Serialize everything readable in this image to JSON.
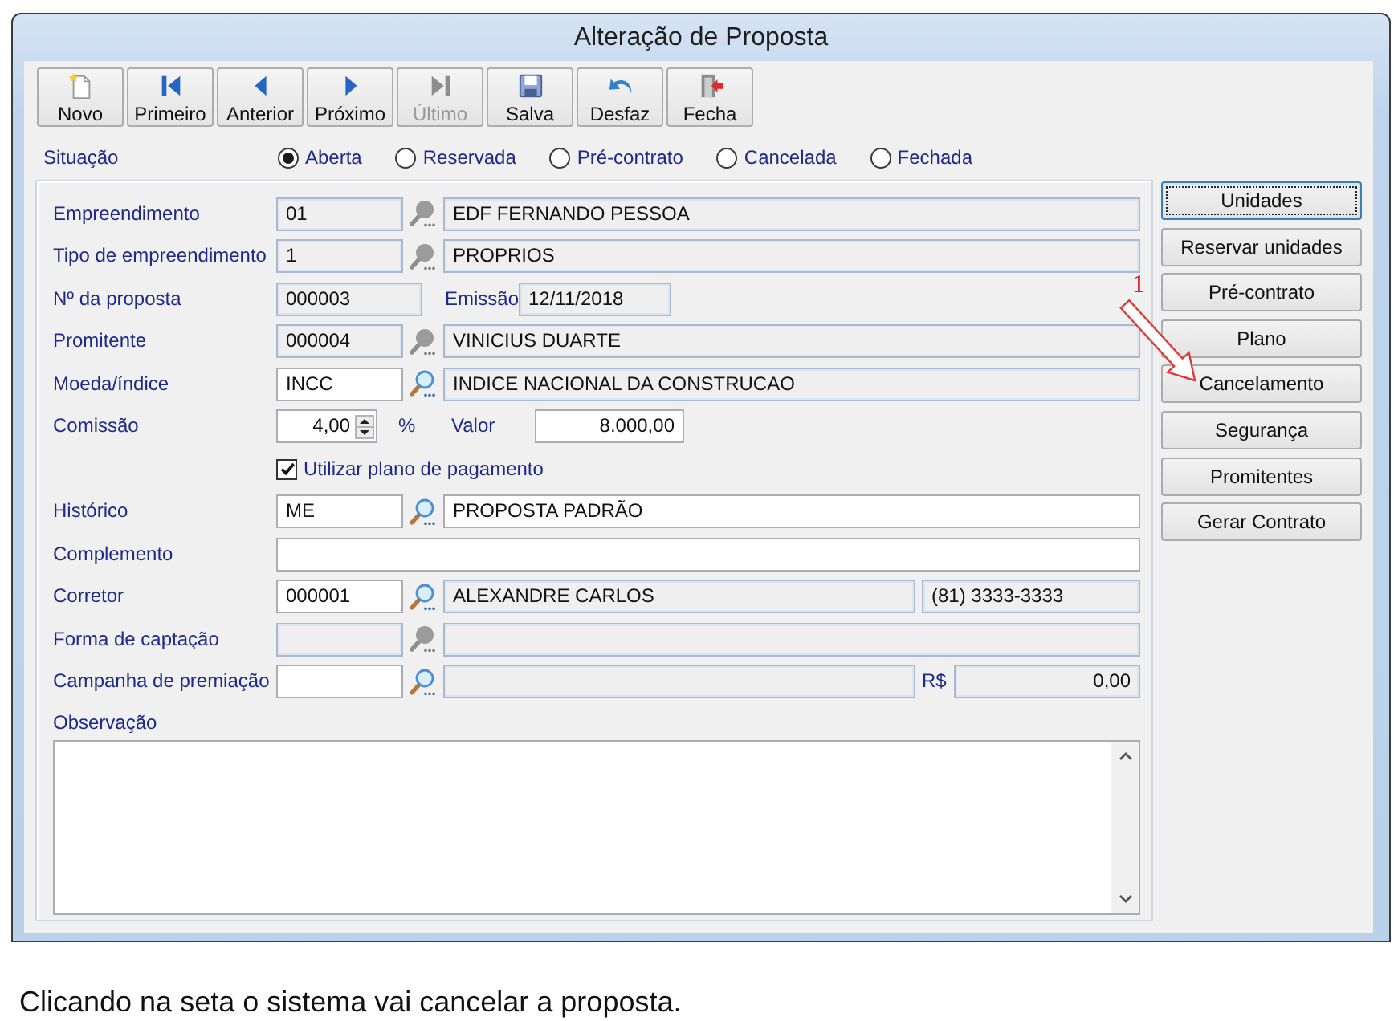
{
  "window": {
    "title": "Alteração de Proposta"
  },
  "toolbar": [
    {
      "kind": "new",
      "label": "Novo",
      "disabled": false
    },
    {
      "kind": "first",
      "label": "Primeiro",
      "disabled": false
    },
    {
      "kind": "previous",
      "label": "Anterior",
      "disabled": false
    },
    {
      "kind": "next",
      "label": "Próximo",
      "disabled": false
    },
    {
      "kind": "last",
      "label": "Último",
      "disabled": true
    },
    {
      "kind": "save",
      "label": "Salva",
      "disabled": false
    },
    {
      "kind": "undo",
      "label": "Desfaz",
      "disabled": false
    },
    {
      "kind": "exit",
      "label": "Fecha",
      "disabled": false
    }
  ],
  "situation": {
    "label": "Situação",
    "options": [
      {
        "label": "Aberta",
        "selected": true
      },
      {
        "label": "Reservada",
        "selected": false
      },
      {
        "label": "Pré-contrato",
        "selected": false
      },
      {
        "label": "Cancelada",
        "selected": false
      },
      {
        "label": "Fechada",
        "selected": false
      }
    ]
  },
  "form": [
    {
      "kind": "lookup",
      "label": "Empreendimento",
      "code": {
        "value": "01",
        "editable": false
      },
      "search_enabled": false,
      "description": {
        "value": "EDF FERNANDO PESSOA",
        "editable": false
      }
    },
    {
      "kind": "lookup",
      "label": "Tipo de empreendimento",
      "code": {
        "value": "1",
        "editable": false
      },
      "search_enabled": false,
      "description": {
        "value": "PROPRIOS",
        "editable": false
      }
    },
    {
      "kind": "number_date",
      "label": "Nº da proposta",
      "number": {
        "value": "000003",
        "editable": false
      },
      "date_label": "Emissão",
      "date": {
        "value": "12/11/2018",
        "editable": false
      }
    },
    {
      "kind": "lookup",
      "label": "Promitente",
      "code": {
        "value": "000004",
        "editable": false
      },
      "search_enabled": false,
      "description": {
        "value": "VINICIUS DUARTE",
        "editable": false
      }
    },
    {
      "kind": "lookup",
      "label": "Moeda/índice",
      "code": {
        "value": "INCC",
        "editable": true
      },
      "search_enabled": true,
      "description": {
        "value": "INDICE NACIONAL DA CONSTRUCAO",
        "editable": false
      }
    },
    {
      "kind": "percent_amount",
      "label": "Comissão",
      "percent": {
        "value": "4,00",
        "editable": true
      },
      "unit": "%",
      "amount_label": "Valor",
      "amount": {
        "value": "8.000,00",
        "editable": true
      }
    },
    {
      "kind": "checkbox",
      "label": "Utilizar plano de pagamento",
      "checked": true
    },
    {
      "kind": "lookup",
      "label": "Histórico",
      "code": {
        "value": "ME",
        "editable": true
      },
      "search_enabled": true,
      "description": {
        "value": "PROPOSTA PADRÃO",
        "editable": true
      }
    },
    {
      "kind": "text",
      "label": "Complemento",
      "field": {
        "editable": true
      }
    },
    {
      "kind": "lookup_phone",
      "label": "Corretor",
      "code": {
        "value": "000001",
        "editable": true
      },
      "search_enabled": true,
      "description": {
        "value": "ALEXANDRE CARLOS",
        "editable": false
      },
      "phone": {
        "value": "(81) 3333-3333",
        "editable": false
      }
    },
    {
      "kind": "lookup",
      "label": "Forma de captação",
      "code": {
        "editable": false
      },
      "search_enabled": false,
      "description": {
        "editable": false
      }
    },
    {
      "kind": "lookup_amount",
      "label": "Campanha de premiação",
      "code": {
        "editable": true
      },
      "search_enabled": true,
      "description": {
        "editable": false
      },
      "currency_label": "R$",
      "amount": {
        "value": "0,00",
        "editable": false
      }
    },
    {
      "kind": "memo",
      "label": "Observação",
      "field": {
        "editable": true
      }
    }
  ],
  "actions": [
    {
      "label": "Unidades",
      "focused": true
    },
    {
      "label": "Reservar unidades",
      "focused": false
    },
    {
      "label": "Pré-contrato",
      "focused": false
    },
    {
      "label": "Plano",
      "focused": false
    },
    {
      "label": "Cancelamento",
      "focused": false
    },
    {
      "label": "Segurança",
      "focused": false
    },
    {
      "label": "Promitentes",
      "focused": false
    },
    {
      "label": "Gerar Contrato",
      "focused": false
    }
  ],
  "annotation": {
    "number": "1"
  },
  "caption": "Clicando na seta o sistema vai cancelar a proposta."
}
